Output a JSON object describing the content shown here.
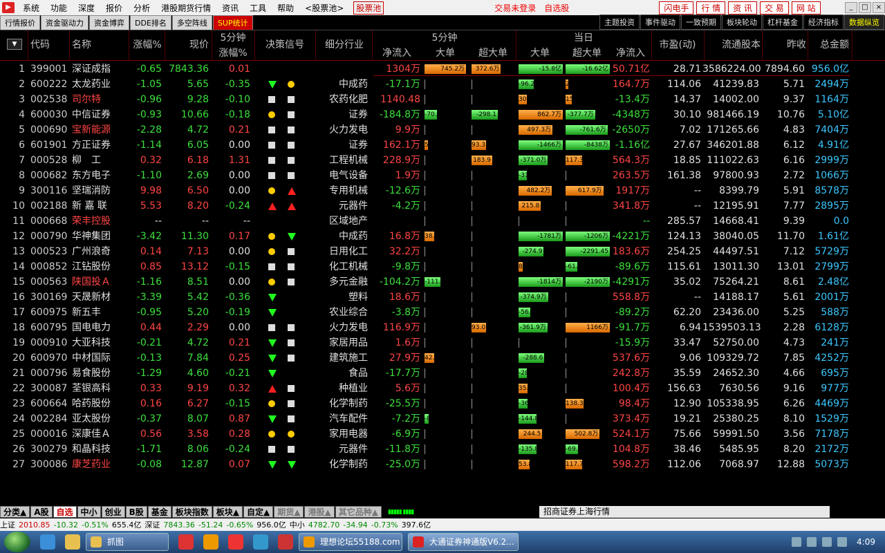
{
  "menu": {
    "items": [
      "系统",
      "功能",
      "深度",
      "报价",
      "分析",
      "港股期货行情",
      "资讯",
      "工具",
      "帮助",
      "<股票池>"
    ],
    "pool": "股票池",
    "not_logged": "交易未登录",
    "self_pick": "自选股",
    "right_buttons": [
      "闪电手",
      "行 情",
      "资 讯",
      "交 易",
      "网 站"
    ],
    "window_controls": [
      "_",
      "□",
      "×"
    ]
  },
  "tabs": {
    "left": [
      "行情报价",
      "资金驱动力",
      "资金博弈",
      "DDE排名",
      "多空阵线",
      "SUP统计"
    ],
    "right": [
      "主题投资",
      "事件驱动",
      "一致预期",
      "板块轮动",
      "杠杆基金",
      "经济指标",
      "数据纵览"
    ]
  },
  "header": {
    "code": "代码",
    "name": "名称",
    "change_pct": "涨幅%",
    "price": "现价",
    "five_min": "5分钟",
    "five_min_change": "涨幅%",
    "decision": "决策信号",
    "industry": "细分行业",
    "flow_5min": "5分钟",
    "net_inflow": "净流入",
    "big": "大单",
    "super_big": "超大单",
    "today": "当日",
    "big_today": "大单",
    "super_today": "超大单",
    "net_today": "净流入",
    "pe": "市盈(动)",
    "float_shares": "流通股本",
    "prev_close": "昨收",
    "amount": "总金额",
    "sort_icon": "▼"
  },
  "rows": [
    {
      "i": "1",
      "code": "399001",
      "name": "深证成指",
      "chg": "-0.65",
      "price": "7843.36",
      "m5": "0.01",
      "sig": [
        "",
        ""
      ],
      "ind": "",
      "net5": "1304万",
      "b5": "745.2万",
      "sb5": "372.6万",
      "bd": "-15.8亿",
      "sbd": "-16.62亿",
      "netd": "50.71亿",
      "pe": "28.71",
      "fs": "3586224.00",
      "pc": "7894.60",
      "amt": "956.0亿",
      "nameRed": false
    },
    {
      "i": "2",
      "code": "600222",
      "name": "太龙药业",
      "chg": "-1.05",
      "price": "5.65",
      "m5": "-0.35",
      "sig": [
        "dn",
        "circ"
      ],
      "ind": "中成药",
      "net5": "-17.1万",
      "b5": "",
      "sb5": "",
      "bd": "-96.2万",
      "sbd": "2.7万",
      "netd": "164.7万",
      "pe": "114.06",
      "fs": "41239.83",
      "pc": "5.71",
      "amt": "2494万",
      "nameRed": false
    },
    {
      "i": "3",
      "code": "002538",
      "name": "司尔特",
      "chg": "-0.96",
      "price": "9.28",
      "m5": "-0.10",
      "sig": [
        "sq",
        "sq"
      ],
      "ind": "农药化肥",
      "net5": "1140.48",
      "b5": "",
      "sb5": "",
      "bd": "30.3万",
      "sbd": "15.1万",
      "netd": "-13.4万",
      "pe": "14.37",
      "fs": "14002.00",
      "pc": "9.37",
      "amt": "1164万",
      "nameRed": true
    },
    {
      "i": "4",
      "code": "600030",
      "name": "中信证券",
      "chg": "-0.93",
      "price": "10.66",
      "m5": "-0.18",
      "sig": [
        "circ",
        "sq"
      ],
      "ind": "证券",
      "net5": "-184.8万",
      "b5": "-70.4万",
      "sb5": "-298.1万",
      "bd": "862.7万",
      "sbd": "-377.7万",
      "netd": "-4348万",
      "pe": "30.10",
      "fs": "981466.19",
      "pc": "10.76",
      "amt": "5.10亿",
      "nameRed": false
    },
    {
      "i": "5",
      "code": "000690",
      "name": "宝新能源",
      "chg": "-2.28",
      "price": "4.72",
      "m5": "0.21",
      "sig": [
        "sq",
        "sq"
      ],
      "ind": "火力发电",
      "net5": "9.9万",
      "b5": "",
      "sb5": "",
      "bd": "497.3万",
      "sbd": "-761.6万",
      "netd": "-2650万",
      "pe": "7.02",
      "fs": "171265.66",
      "pc": "4.83",
      "amt": "7404万",
      "nameRed": true
    },
    {
      "i": "6",
      "code": "601901",
      "name": "方正证券",
      "chg": "-1.14",
      "price": "6.05",
      "m5": "0.00",
      "sig": [
        "sq",
        "sq"
      ],
      "ind": "证券",
      "net5": "162.1万",
      "b5": "5.9万",
      "sb5": "93.3万",
      "bd": "-1466万",
      "sbd": "-8438万",
      "netd": "-1.16亿",
      "pe": "27.67",
      "fs": "346201.88",
      "pc": "6.12",
      "amt": "4.91亿",
      "nameRed": false
    },
    {
      "i": "7",
      "code": "000528",
      "name": "柳　工",
      "chg": "0.32",
      "price": "6.18",
      "m5": "1.31",
      "sig": [
        "sq",
        "sq"
      ],
      "ind": "工程机械",
      "net5": "228.9万",
      "b5": "",
      "sb5": "183.9万",
      "bd": "-371.0万",
      "sbd": "117.3万",
      "netd": "564.3万",
      "pe": "18.85",
      "fs": "111022.63",
      "pc": "6.16",
      "amt": "2999万",
      "nameRed": false
    },
    {
      "i": "8",
      "code": "000682",
      "name": "东方电子",
      "chg": "-1.10",
      "price": "2.69",
      "m5": "0.00",
      "sig": [
        "sq",
        "sq"
      ],
      "ind": "电气设备",
      "net5": "1.9万",
      "b5": "",
      "sb5": "",
      "bd": "-31.1万",
      "sbd": "",
      "netd": "263.5万",
      "pe": "161.38",
      "fs": "97800.93",
      "pc": "2.72",
      "amt": "1066万",
      "nameRed": false
    },
    {
      "i": "9",
      "code": "300116",
      "name": "坚瑞消防",
      "chg": "9.98",
      "price": "6.50",
      "m5": "0.00",
      "sig": [
        "circ",
        "up"
      ],
      "ind": "专用机械",
      "net5": "-12.6万",
      "b5": "",
      "sb5": "",
      "bd": "482.2万",
      "sbd": "617.9万",
      "netd": "1917万",
      "pe": "--",
      "fs": "8399.79",
      "pc": "5.91",
      "amt": "8578万",
      "nameRed": false
    },
    {
      "i": "10",
      "code": "002188",
      "name": "新 嘉 联",
      "chg": "5.53",
      "price": "8.20",
      "m5": "-0.24",
      "sig": [
        "up",
        "up"
      ],
      "ind": "元器件",
      "net5": "-4.2万",
      "b5": "",
      "sb5": "",
      "bd": "215.8万",
      "sbd": "",
      "netd": "341.8万",
      "pe": "--",
      "fs": "12195.91",
      "pc": "7.77",
      "amt": "2895万",
      "nameRed": false
    },
    {
      "i": "11",
      "code": "000668",
      "name": "荣丰控股",
      "chg": "--",
      "price": "--",
      "m5": "--",
      "sig": [
        "",
        ""
      ],
      "ind": "区域地产",
      "net5": "",
      "b5": "",
      "sb5": "",
      "bd": "",
      "sbd": "",
      "netd": "--",
      "pe": "285.57",
      "fs": "14668.41",
      "pc": "9.39",
      "amt": "0.0",
      "nameRed": true
    },
    {
      "i": "12",
      "code": "000790",
      "name": "华神集团",
      "chg": "-3.42",
      "price": "11.30",
      "m5": "0.17",
      "sig": [
        "circ",
        "dn"
      ],
      "ind": "中成药",
      "net5": "16.8万",
      "b5": "38.7万",
      "sb5": "",
      "bd": "-1781万",
      "sbd": "-1206万",
      "netd": "-4221万",
      "pe": "124.13",
      "fs": "38040.05",
      "pc": "11.70",
      "amt": "1.61亿",
      "nameRed": false
    },
    {
      "i": "13",
      "code": "000523",
      "name": "广州浪奇",
      "chg": "0.14",
      "price": "7.13",
      "m5": "0.00",
      "sig": [
        "circ",
        "sq"
      ],
      "ind": "日用化工",
      "net5": "32.2万",
      "b5": "",
      "sb5": "",
      "bd": "-274.9万",
      "sbd": "-2291.45",
      "netd": "183.6万",
      "pe": "254.25",
      "fs": "44497.51",
      "pc": "7.12",
      "amt": "5729万",
      "nameRed": false
    },
    {
      "i": "14",
      "code": "000852",
      "name": "江钻股份",
      "chg": "0.85",
      "price": "13.12",
      "m5": "-0.15",
      "sig": [
        "sq",
        "sq"
      ],
      "ind": "化工机械",
      "net5": "-9.8万",
      "b5": "",
      "sb5": "",
      "bd": "8.5万",
      "sbd": "-61.4万",
      "netd": "-89.6万",
      "pe": "115.61",
      "fs": "13011.30",
      "pc": "13.01",
      "amt": "2799万",
      "nameRed": false
    },
    {
      "i": "15",
      "code": "000563",
      "name": "陕国投Ａ",
      "chg": "-1.16",
      "price": "8.51",
      "m5": "0.00",
      "sig": [
        "circ",
        "sq"
      ],
      "ind": "多元金融",
      "net5": "-104.2万",
      "b5": "-111.1万",
      "sb5": "",
      "bd": "-1814万",
      "sbd": "-2190万",
      "netd": "-4291万",
      "pe": "35.02",
      "fs": "75264.21",
      "pc": "8.61",
      "amt": "2.48亿",
      "nameRed": true
    },
    {
      "i": "16",
      "code": "300169",
      "name": "天晟新材",
      "chg": "-3.39",
      "price": "5.42",
      "m5": "-0.36",
      "sig": [
        "dn",
        ""
      ],
      "ind": "塑料",
      "net5": "18.6万",
      "b5": "",
      "sb5": "",
      "bd": "-374.9万",
      "sbd": "",
      "netd": "558.8万",
      "pe": "--",
      "fs": "14188.17",
      "pc": "5.61",
      "amt": "2001万",
      "nameRed": false
    },
    {
      "i": "17",
      "code": "600975",
      "name": "新五丰",
      "chg": "-0.95",
      "price": "5.20",
      "m5": "-0.19",
      "sig": [
        "dn",
        ""
      ],
      "ind": "农业综合",
      "net5": "-3.8万",
      "b5": "",
      "sb5": "",
      "bd": "-56.7万",
      "sbd": "",
      "netd": "-89.2万",
      "pe": "62.20",
      "fs": "23436.00",
      "pc": "5.25",
      "amt": "588万",
      "nameRed": false
    },
    {
      "i": "18",
      "code": "600795",
      "name": "国电电力",
      "chg": "0.44",
      "price": "2.29",
      "m5": "0.00",
      "sig": [
        "sq",
        "sq"
      ],
      "ind": "火力发电",
      "net5": "116.9万",
      "b5": "",
      "sb5": "93.0万",
      "bd": "-361.9万",
      "sbd": "1166万",
      "netd": "-91.7万",
      "pe": "6.94",
      "fs": "1539503.13",
      "pc": "2.28",
      "amt": "6128万",
      "nameRed": false
    },
    {
      "i": "19",
      "code": "000910",
      "name": "大亚科技",
      "chg": "-0.21",
      "price": "4.72",
      "m5": "0.21",
      "sig": [
        "dn",
        "sq"
      ],
      "ind": "家居用品",
      "net5": "1.6万",
      "b5": "",
      "sb5": "",
      "bd": "",
      "sbd": "",
      "netd": "-15.9万",
      "pe": "33.47",
      "fs": "52750.00",
      "pc": "4.73",
      "amt": "241万",
      "nameRed": false
    },
    {
      "i": "20",
      "code": "600970",
      "name": "中材国际",
      "chg": "-0.13",
      "price": "7.84",
      "m5": "0.25",
      "sig": [
        "dn",
        "sq"
      ],
      "ind": "建筑施工",
      "net5": "27.9万",
      "b5": "42.3万",
      "sb5": "",
      "bd": "-288.6万",
      "sbd": "",
      "netd": "537.6万",
      "pe": "9.06",
      "fs": "109329.72",
      "pc": "7.85",
      "amt": "4252万",
      "nameRed": false
    },
    {
      "i": "21",
      "code": "000796",
      "name": "易食股份",
      "chg": "-1.29",
      "price": "4.60",
      "m5": "-0.21",
      "sig": [
        "dn",
        ""
      ],
      "ind": "食品",
      "net5": "-17.7万",
      "b5": "",
      "sb5": "",
      "bd": "-28.6万",
      "sbd": "",
      "netd": "242.8万",
      "pe": "35.59",
      "fs": "24652.30",
      "pc": "4.66",
      "amt": "695万",
      "nameRed": false
    },
    {
      "i": "22",
      "code": "300087",
      "name": "荃银高科",
      "chg": "0.33",
      "price": "9.19",
      "m5": "0.32",
      "sig": [
        "up",
        "sq"
      ],
      "ind": "种植业",
      "net5": "5.6万",
      "b5": "",
      "sb5": "",
      "bd": "35.4万",
      "sbd": "",
      "netd": "100.4万",
      "pe": "156.63",
      "fs": "7630.56",
      "pc": "9.16",
      "amt": "977万",
      "nameRed": false
    },
    {
      "i": "23",
      "code": "600664",
      "name": "哈药股份",
      "chg": "0.16",
      "price": "6.27",
      "m5": "-0.15",
      "sig": [
        "circ",
        "sq"
      ],
      "ind": "化学制药",
      "net5": "-25.5万",
      "b5": "",
      "sb5": "",
      "bd": "-36.6万",
      "sbd": "138.3万",
      "netd": "98.4万",
      "pe": "12.90",
      "fs": "105338.95",
      "pc": "6.26",
      "amt": "4469万",
      "nameRed": false
    },
    {
      "i": "24",
      "code": "002284",
      "name": "亚太股份",
      "chg": "-0.37",
      "price": "8.07",
      "m5": "0.87",
      "sig": [
        "dn",
        "sq"
      ],
      "ind": "汽车配件",
      "net5": "-7.2万",
      "b5": "-8.0万",
      "sb5": "",
      "bd": "-144.8万",
      "sbd": "",
      "netd": "373.4万",
      "pe": "19.21",
      "fs": "25380.25",
      "pc": "8.10",
      "amt": "1529万",
      "nameRed": false
    },
    {
      "i": "25",
      "code": "000016",
      "name": "深康佳Ａ",
      "chg": "0.56",
      "price": "3.58",
      "m5": "0.28",
      "sig": [
        "circ",
        "circ"
      ],
      "ind": "家用电器",
      "net5": "-6.9万",
      "b5": "",
      "sb5": "",
      "bd": "244.5万",
      "sbd": "502.8万",
      "netd": "524.1万",
      "pe": "75.66",
      "fs": "59991.50",
      "pc": "3.56",
      "amt": "7178万",
      "nameRed": false
    },
    {
      "i": "26",
      "code": "300279",
      "name": "和晶科技",
      "chg": "-1.71",
      "price": "8.06",
      "m5": "-0.24",
      "sig": [
        "sq",
        "sq"
      ],
      "ind": "元器件",
      "net5": "-11.8万",
      "b5": "",
      "sb5": "",
      "bd": "-135.8万",
      "sbd": "-69.5万",
      "netd": "104.8万",
      "pe": "38.46",
      "fs": "5485.95",
      "pc": "8.20",
      "amt": "2172万",
      "nameRed": false
    },
    {
      "i": "27",
      "code": "300086",
      "name": "康芝药业",
      "chg": "-0.08",
      "price": "12.87",
      "m5": "0.07",
      "sig": [
        "dn",
        "dn"
      ],
      "ind": "化学制药",
      "net5": "-25.0万",
      "b5": "",
      "sb5": "",
      "bd": "53.8万",
      "sbd": "117.7万",
      "netd": "598.2万",
      "pe": "112.06",
      "fs": "7068.97",
      "pc": "12.88",
      "amt": "5073万",
      "nameRed": true
    }
  ],
  "bottom_tabs": [
    "分类▲",
    "A股",
    "自选",
    "中小",
    "创业",
    "B股",
    "基金",
    "板块指数",
    "板块▲",
    "自定▲",
    "期货▲",
    "港股▲",
    "其它品种▲"
  ],
  "broker": "招商证券上海行情",
  "status": [
    "上证",
    "2010.85",
    "-10.32",
    "-0.51%",
    "655.4亿",
    "深证",
    "7843.36",
    "-51.24",
    "-0.65%",
    "956.0亿",
    "中小",
    "4782.70",
    "-34.94",
    "-0.73%",
    "397.6亿"
  ],
  "taskbar": {
    "items": [
      "抓图",
      "理想论坛55188.com",
      "大通证券神通版V6.2..."
    ],
    "time": "4:09"
  },
  "colors": {
    "up": "#ff4545",
    "down": "#3de03d",
    "amount": "#3cc8ff",
    "bar_buy": "#ff9a20",
    "bar_sell": "#3ddd3d"
  }
}
